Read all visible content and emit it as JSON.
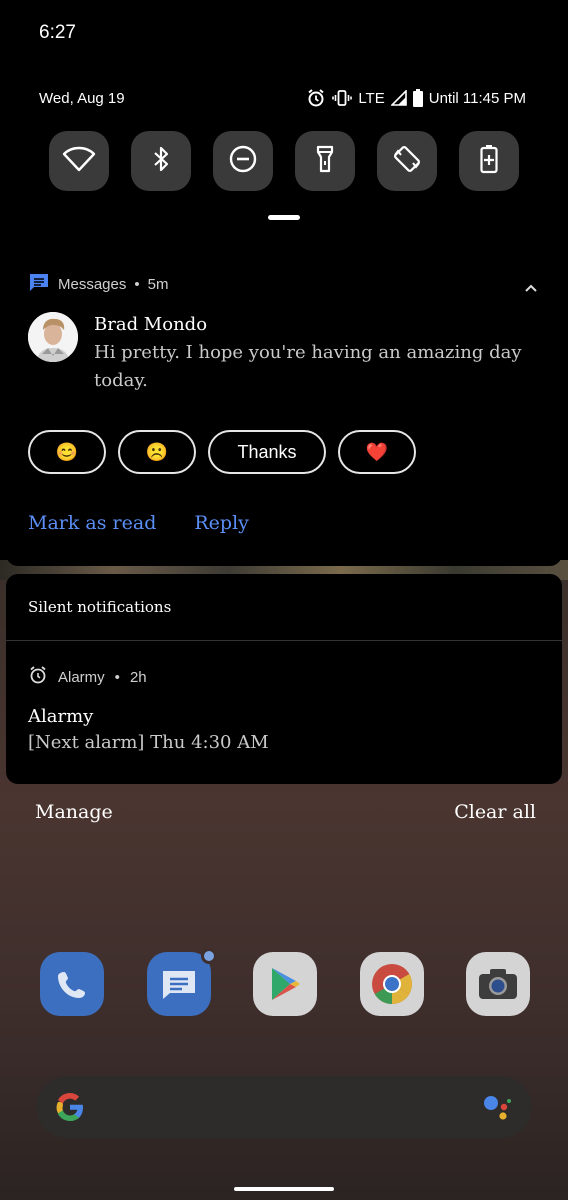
{
  "status_bar": {
    "time": "6:27"
  },
  "quick_settings": {
    "date": "Wed, Aug 19",
    "network": "LTE",
    "battery_text": "Until 11:45 PM",
    "tiles": [
      "wifi-icon",
      "bluetooth-icon",
      "do-not-disturb-icon",
      "flashlight-icon",
      "auto-rotate-icon",
      "battery-saver-icon"
    ]
  },
  "message_notification": {
    "app_name": "Messages",
    "separator": "•",
    "time_ago": "5m",
    "sender": "Brad Mondo",
    "text": "Hi pretty. I hope you're having an amazing day today.",
    "smart_replies": [
      "😊",
      "☹️",
      "Thanks",
      "❤️"
    ],
    "actions": {
      "mark_as_read": "Mark as read",
      "reply": "Reply"
    },
    "accent_color": "#5b8ff5"
  },
  "silent": {
    "header": "Silent notifications",
    "app_name": "Alarmy",
    "separator": "•",
    "time_ago": "2h",
    "title": "Alarmy",
    "text": "[Next alarm] Thu 4:30 AM"
  },
  "footer": {
    "manage": "Manage",
    "clear_all": "Clear all"
  },
  "dock": [
    "phone-app-icon",
    "messages-app-icon",
    "play-store-app-icon",
    "chrome-app-icon",
    "camera-app-icon"
  ]
}
